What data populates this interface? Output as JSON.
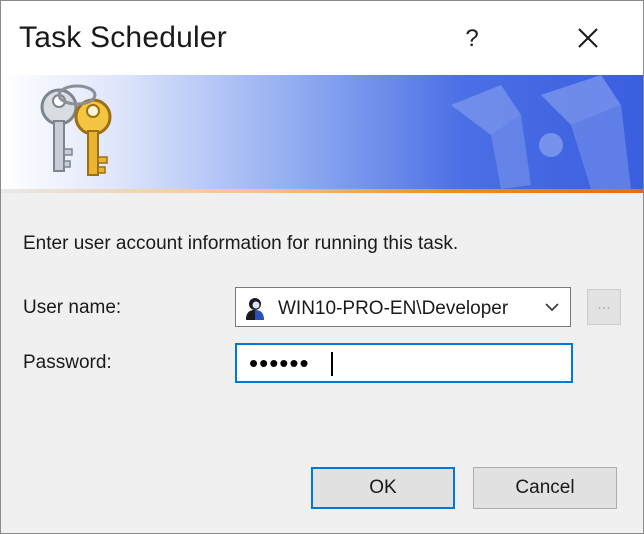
{
  "window": {
    "title": "Task Scheduler",
    "help_label": "?"
  },
  "dialog": {
    "instruction": "Enter user account information for running this task.",
    "user_name_label": "User name:",
    "user_name_value": "WIN10-PRO-EN\\Developer",
    "password_label": "Password:",
    "password_mask": "••••••",
    "browse_label": "...",
    "ok_label": "OK",
    "cancel_label": "Cancel"
  },
  "icons": {
    "banner": "keys-icon",
    "user": "user-icon",
    "dropdown": "chevron-down-icon",
    "close": "close-icon"
  },
  "colors": {
    "accent": "#0078d7",
    "banner_blue": "#3a5ee0",
    "banner_orange": "#ea6a1b"
  }
}
